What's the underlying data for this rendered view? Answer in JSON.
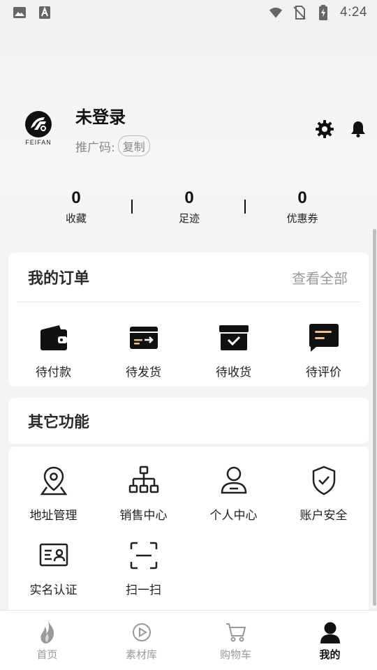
{
  "status_bar": {
    "time": "4:24",
    "left_icons": [
      "image-icon",
      "a-keyboard-icon"
    ],
    "right_icons": [
      "wifi-icon",
      "no-sim-icon",
      "battery-charging-icon"
    ]
  },
  "profile": {
    "brand_text": "FEIFAN",
    "user_name": "未登录",
    "promo_label": "推广码:",
    "copy_label": "复制",
    "action_icons": [
      "settings-icon",
      "bell-icon"
    ]
  },
  "stats": [
    {
      "value": "0",
      "label": "收藏"
    },
    {
      "value": "0",
      "label": "足迹"
    },
    {
      "value": "0",
      "label": "优惠券"
    }
  ],
  "orders": {
    "title": "我的订单",
    "view_all": "查看全部",
    "items": [
      {
        "label": "待付款",
        "icon": "wallet-icon"
      },
      {
        "label": "待发货",
        "icon": "box-ship-icon"
      },
      {
        "label": "待收货",
        "icon": "box-check-icon"
      },
      {
        "label": "待评价",
        "icon": "comment-icon"
      }
    ]
  },
  "other": {
    "title": "其它功能",
    "items": [
      {
        "label": "地址管理",
        "icon": "location-pin-icon"
      },
      {
        "label": "销售中心",
        "icon": "org-chart-icon"
      },
      {
        "label": "个人中心",
        "icon": "user-icon"
      },
      {
        "label": "账户安全",
        "icon": "shield-check-icon"
      },
      {
        "label": "实名认证",
        "icon": "id-card-icon"
      },
      {
        "label": "扫一扫",
        "icon": "scan-icon"
      }
    ]
  },
  "tabbar": {
    "tabs": [
      {
        "label": "首页",
        "icon": "flame-logo-icon",
        "active": false
      },
      {
        "label": "素材库",
        "icon": "play-circle-icon",
        "active": false
      },
      {
        "label": "购物车",
        "icon": "cart-icon",
        "active": false
      },
      {
        "label": "我的",
        "icon": "profile-icon",
        "active": true
      }
    ]
  },
  "colors": {
    "accent": "#111111",
    "muted": "#999999",
    "background": "#f4f4f4",
    "card": "#ffffff"
  }
}
